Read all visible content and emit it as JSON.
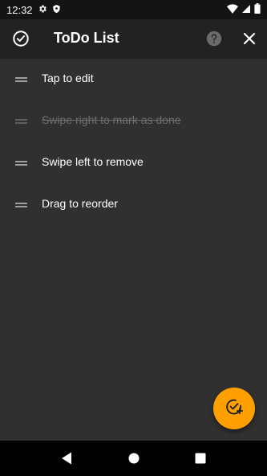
{
  "status_bar": {
    "time": "12:32"
  },
  "app_bar": {
    "title": "ToDo List",
    "icons": [
      "check-circle-icon",
      "help-icon",
      "close-icon"
    ]
  },
  "todos": [
    {
      "text": "Tap to edit",
      "done": false
    },
    {
      "text": "Swipe right to mark as done",
      "done": true
    },
    {
      "text": "Swipe left to remove",
      "done": false
    },
    {
      "text": "Drag to reorder",
      "done": false
    }
  ],
  "fab": {
    "icon": "add-task-icon",
    "color": "#ffa000"
  },
  "colors": {
    "background": "#303030",
    "app_bar": "#222222",
    "accent": "#ffa000"
  }
}
